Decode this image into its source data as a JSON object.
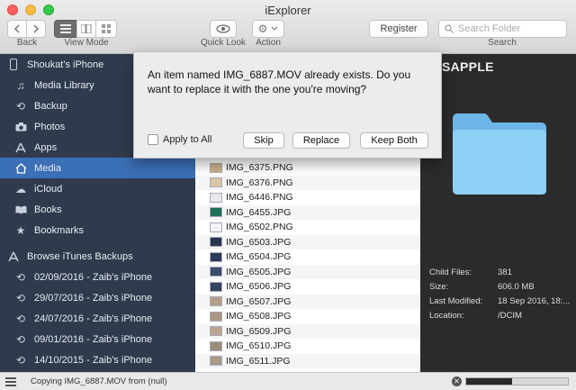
{
  "window": {
    "title": "iExplorer"
  },
  "toolbar": {
    "back_label": "Back",
    "view_mode_label": "View Mode",
    "quick_look_label": "Quick Look",
    "action_label": "Action",
    "register_label": "Register",
    "search_placeholder": "Search Folder",
    "search_label": "Search"
  },
  "sidebar": {
    "device": "Shoukat's iPhone",
    "items": [
      {
        "label": "Media Library",
        "icon": "music-note-icon"
      },
      {
        "label": "Backup",
        "icon": "backup-icon"
      },
      {
        "label": "Photos",
        "icon": "camera-icon"
      },
      {
        "label": "Apps",
        "icon": "apps-icon"
      },
      {
        "label": "Media",
        "icon": "home-icon",
        "selected": true
      },
      {
        "label": "iCloud",
        "icon": "cloud-icon"
      },
      {
        "label": "Books",
        "icon": "book-icon"
      },
      {
        "label": "Bookmarks",
        "icon": "star-icon"
      }
    ],
    "backups_header": "Browse iTunes Backups",
    "backups": [
      "02/09/2016 - Zaib's iPhone",
      "29/07/2016 - Zaib's iPhone",
      "24/07/2016 - Zaib's iPhone",
      "09/01/2016 - Zaib's iPhone",
      "14/10/2015 - Zaib's iPhone"
    ]
  },
  "files": [
    "IMG_6375.PNG",
    "IMG_6376.PNG",
    "IMG_6446.PNG",
    "IMG_6455.JPG",
    "IMG_6502.PNG",
    "IMG_6503.JPG",
    "IMG_6504.JPG",
    "IMG_6505.JPG",
    "IMG_6506.JPG",
    "IMG_6507.JPG",
    "IMG_6508.JPG",
    "IMG_6509.JPG",
    "IMG_6510.JPG",
    "IMG_6511.JPG"
  ],
  "details": {
    "title": "SAPPLE",
    "child_files_label": "Child Files:",
    "child_files_value": "381",
    "size_label": "Size:",
    "size_value": "606.0 MB",
    "last_modified_label": "Last Modified:",
    "last_modified_value": "18 Sep 2016, 18:...",
    "location_label": "Location:",
    "location_value": "/DCIM"
  },
  "dialog": {
    "message": "An item named IMG_6887.MOV already exists. Do you want to replace it with the one you're moving?",
    "apply_to_all_label": "Apply to All",
    "skip_label": "Skip",
    "replace_label": "Replace",
    "keep_both_label": "Keep Both"
  },
  "status": {
    "text": "Copying IMG_6887.MOV from (null)",
    "progress": 0.45
  },
  "colors": {
    "sidebar_bg": "#2f3b4c",
    "sidebar_selected": "#3b6fb6",
    "detail_bg": "#2b2b2b",
    "folder": "#7fc4f2"
  }
}
